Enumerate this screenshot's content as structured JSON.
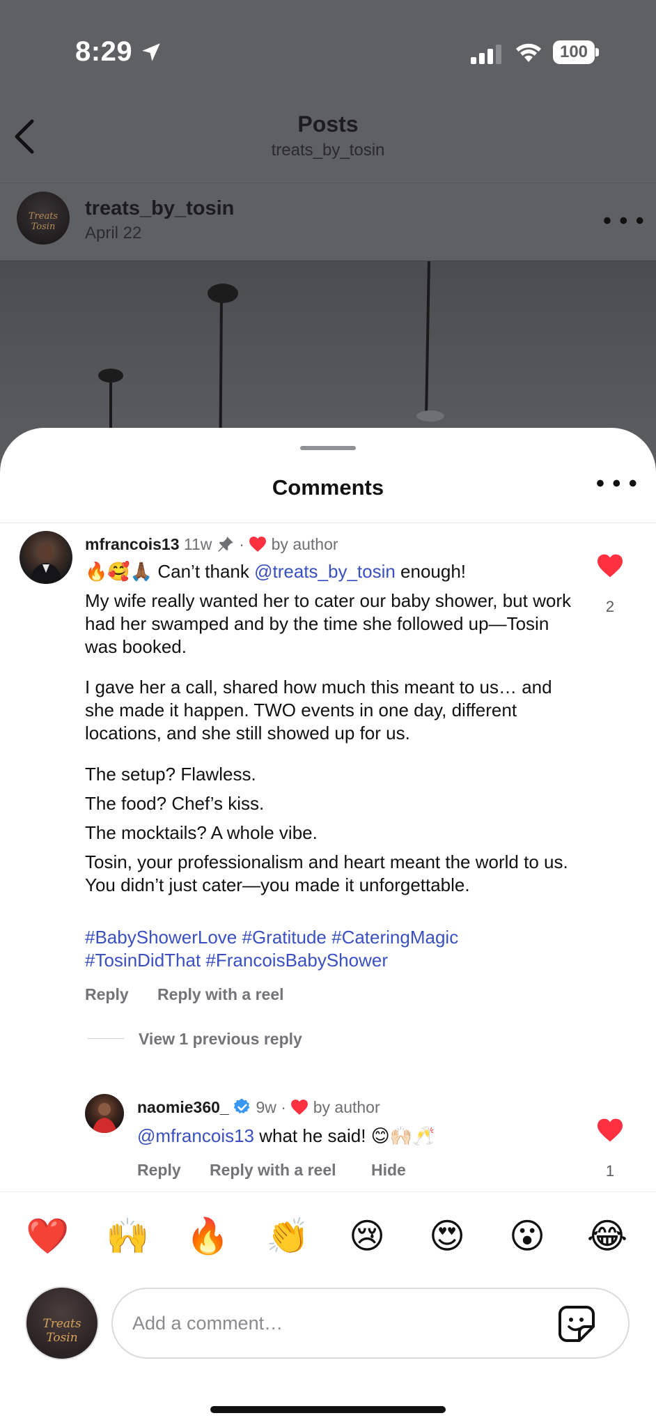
{
  "status_bar": {
    "time": "8:29",
    "battery": "100"
  },
  "nav": {
    "title": "Posts",
    "subtitle": "treats_by_tosin"
  },
  "post": {
    "username": "treats_by_tosin",
    "date": "April 22",
    "avatar_text": "Treats Tosin"
  },
  "sheet": {
    "title": "Comments"
  },
  "comments": [
    {
      "username": "mfrancois13",
      "time": "11w",
      "dot": "·",
      "liked_by": "by author",
      "intro_emoji": "🔥🥰🙏🏾",
      "intro_pre": " Can’t thank ",
      "mention": "@treats_by_tosin",
      "intro_post": " enough!",
      "paragraphs": [
        "My wife really wanted her to cater our baby shower, but work had her swamped and by the time she followed up—Tosin was booked.",
        "I gave her a call, shared how much this meant to us… and she made it happen. TWO events in one day, different locations, and she still showed up for us.",
        "The setup? Flawless.",
        "The food? Chef’s kiss.",
        "The mocktails? A whole vibe.",
        "Tosin, your professionalism and heart meant the world to us. You didn’t just cater—you made it unforgettable."
      ],
      "hashtags_line1": "#BabyShowerLove #Gratitude #CateringMagic",
      "hashtags_line2": "#TosinDidThat #FrancoisBabyShower",
      "like_count": "2",
      "reply_label": "Reply",
      "reel_label": "Reply with a reel",
      "view_replies": "View 1 previous reply"
    },
    {
      "username": "naomie360_",
      "time": "9w",
      "dot": "·",
      "liked_by": "by author",
      "mention": "@mfrancois13",
      "text": " what he said! 😊🙌🏻🥂",
      "like_count": "1",
      "reply_label": "Reply",
      "reel_label": "Reply with a reel",
      "hide_label": "Hide"
    }
  ],
  "reactions": [
    "❤️",
    "🙌",
    "🔥",
    "👏",
    "😢",
    "😍",
    "😮",
    "😂"
  ],
  "composer": {
    "placeholder": "Add a comment…",
    "avatar_text": "Treats Tosin"
  },
  "icons": {
    "back": "chevron-left-icon",
    "location": "location-arrow-icon",
    "more": "more-icon",
    "pin": "pin-icon",
    "heart": "heart-icon",
    "verified": "verified-badge-icon",
    "sticker": "sticker-icon"
  },
  "colors": {
    "heart": "#ff3040",
    "link": "#3a50c0",
    "verified": "#3897f0",
    "dim_background": "#5e6063"
  }
}
